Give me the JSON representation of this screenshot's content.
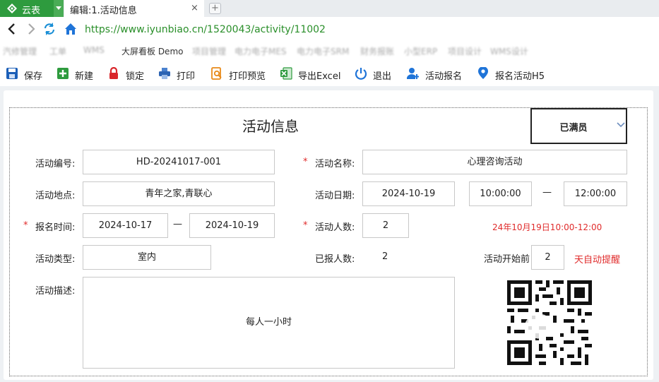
{
  "app": {
    "name": "云表"
  },
  "tab": {
    "title": "编辑:1.活动信息",
    "close_glyph": "×",
    "new_glyph": "+"
  },
  "address": {
    "url": "https://www.iyunbiao.cn/1520043/activity/11002"
  },
  "bookmarks": [
    {
      "label": "汽修管理",
      "faded": true
    },
    {
      "label": "工单",
      "faded": true
    },
    {
      "label": "WMS",
      "faded": true
    },
    {
      "label": "大屏看板 Demo",
      "faded": false
    },
    {
      "label": "项目管理",
      "faded": true
    },
    {
      "label": "电力电子MES",
      "faded": true
    },
    {
      "label": "电力电子SRM",
      "faded": true
    },
    {
      "label": "财务报账",
      "faded": true
    },
    {
      "label": "小型ERP",
      "faded": true
    },
    {
      "label": "项目设计",
      "faded": true
    },
    {
      "label": "WMS设计",
      "faded": true
    }
  ],
  "toolbar": {
    "save": "保存",
    "new": "新建",
    "lock": "锁定",
    "print": "打印",
    "print_preview": "打印预览",
    "export_excel": "导出Excel",
    "exit": "退出",
    "signup": "活动报名",
    "signup_h5": "报名活动H5"
  },
  "form": {
    "title": "活动信息",
    "status": "已满员",
    "labels": {
      "code": "活动编号:",
      "name": "活动名称:",
      "location": "活动地点:",
      "date": "活动日期:",
      "signup_time": "报名时间:",
      "capacity": "活动人数:",
      "type": "活动类型:",
      "registered": "已报人数:",
      "remind_before": "活动开始前",
      "remind_after": "天自动提醒",
      "description": "活动描述:"
    },
    "required_mark": "*",
    "range_sep": "—",
    "values": {
      "code": "HD-20241017-001",
      "name": "心理咨询活动",
      "location": "青年之家,青联心",
      "date": "2024-10-19",
      "start_time": "10:00:00",
      "end_time": "12:00:00",
      "signup_start": "2024-10-17",
      "signup_end": "2024-10-19",
      "capacity": "2",
      "schedule_note": "24年10月19日10:00-12:00",
      "type": "室内",
      "registered": "2",
      "remind_days": "2",
      "description": "每人一小时"
    }
  },
  "colors": {
    "accent_green": "#2e9b3e",
    "required_red": "#e02b2b",
    "url_green": "#2a8f2a"
  },
  "icons": [
    "app-logo-icon",
    "back-arrow-icon",
    "forward-arrow-icon",
    "refresh-icon",
    "home-icon",
    "save-icon",
    "new-icon",
    "lock-icon",
    "print-icon",
    "print-preview-icon",
    "excel-icon",
    "power-icon",
    "user-add-icon",
    "user-pin-icon",
    "chevron-down-icon",
    "qr-code-icon"
  ]
}
